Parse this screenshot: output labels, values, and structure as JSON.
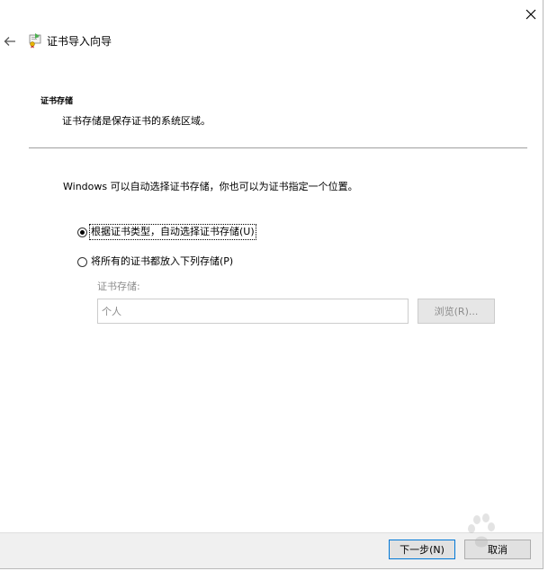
{
  "window": {
    "title": "证书导入向导",
    "close_icon": "close-icon",
    "back_icon": "back-arrow-icon",
    "app_icon": "certificate-icon"
  },
  "section": {
    "heading": "证书存储",
    "description": "证书存储是保存证书的系统区域。"
  },
  "body": {
    "intro": "Windows 可以自动选择证书存储，你也可以为证书指定一个位置。",
    "options": [
      {
        "label": "根据证书类型，自动选择证书存储(U)",
        "checked": true
      },
      {
        "label": "将所有的证书都放入下列存储(P)",
        "checked": false
      }
    ],
    "store_label": "证书存储:",
    "store_value": "个人",
    "browse_label": "浏览(R)..."
  },
  "footer": {
    "next_label": "下一步(N)",
    "cancel_label": "取消"
  },
  "colors": {
    "focus_border": "#0078d7",
    "footer_bg": "#f0f0f0",
    "disabled_text": "#8c8c8c"
  }
}
